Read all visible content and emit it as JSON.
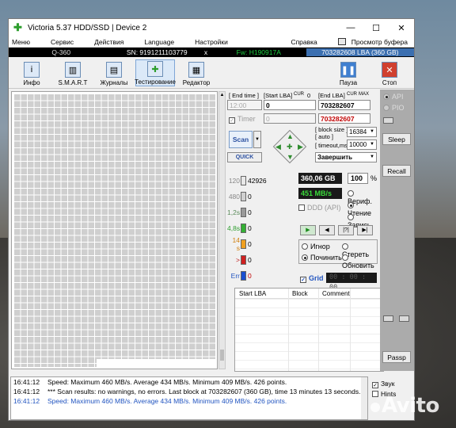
{
  "window": {
    "title": "Victoria 5.37 HDD/SSD | Device 2",
    "minimize": "—",
    "maximize": "☐",
    "close": "✕"
  },
  "menu": {
    "items": [
      "Меню",
      "Сервис",
      "Действия",
      "Language",
      "Настройки",
      "Справка"
    ],
    "clipboard": "Просмотр буфера"
  },
  "infobar": {
    "model": "Q-360",
    "serial": "SN: 9191211103779",
    "sep": "x",
    "firmware": "Fw: H190917A",
    "lba": "703282608 LBA (360 GB)"
  },
  "toolbar": {
    "info": "Инфо",
    "smart": "S.M.A.R.T",
    "logs": "Журналы",
    "testing": "Тестирование",
    "editor": "Редактор",
    "pause": "Пауза",
    "stop": "Стоп"
  },
  "scan": {
    "end_time_label": "[ End time ]",
    "start_lba_label": "[Start LBA]",
    "cur_label": "CUR",
    "cur_value": "0",
    "end_lba_label": "[End LBA]",
    "max_label": "MAX",
    "end_time_value": "12:00",
    "start_lba_value": "0",
    "end_lba_value": "703282607",
    "timer_label": "Timer",
    "timer_value": "0",
    "end_lba_value2": "703282607",
    "scan_button": "Scan",
    "quick_button": "QUICK",
    "block_size_label": "[ block size ]",
    "auto_label": "[ auto ]",
    "block_size_value": "16384",
    "timeout_label": "[ timeout,ms ]",
    "timeout_value": "10000",
    "finish_action": "Завершить"
  },
  "stats": {
    "legend": [
      {
        "ms": "120",
        "count": "42926",
        "color": "#e8e8e8"
      },
      {
        "ms": "480",
        "count": "0",
        "color": "#d0d0d0"
      },
      {
        "ms": "1,2s",
        "count": "0",
        "color": "#9a9a9a"
      },
      {
        "ms": "4,8s",
        "count": "0",
        "color": "#34b034"
      },
      {
        "ms": "14 s",
        "count": "0",
        "color": "#f0a020"
      },
      {
        "ms": ">",
        "count": "0",
        "color": "#d02020"
      },
      {
        "ms": "Err",
        "count": "0",
        "color": "#1a4fd0"
      }
    ],
    "size_done": "360,06 GB",
    "percent_value": "100",
    "percent_sign": "%",
    "speed": "451 MB/s",
    "ddd_label": "DDD (API)",
    "mode_verify": "Вериф.",
    "mode_read": "Чтение",
    "mode_write": "Запись",
    "ignore": "Игнор",
    "erase": "Стереть",
    "repair": "Починить",
    "refresh": "Обновить",
    "grid_label": "Grid",
    "timer_display": "00 : 00 : 00",
    "play_buttons": [
      "▶",
      "◀",
      "|?|",
      "▶|"
    ]
  },
  "table": {
    "headers": [
      "Start LBA",
      "Block",
      "Comment"
    ]
  },
  "rightpanel": {
    "api": "API",
    "pio": "PIO",
    "sleep": "Sleep",
    "recall": "Recall",
    "passp": "Passp"
  },
  "log": [
    {
      "time": "16:41:12",
      "text": "Speed: Maximum 460 MB/s. Average 434 MB/s. Minimum 409 MB/s. 426 points.",
      "color": "black"
    },
    {
      "time": "16:41:12",
      "text": "*** Scan results: no warnings, no errors. Last block at 703282607 (360 GB), time 13 minutes 13 seconds.",
      "color": "black"
    },
    {
      "time": "16:41:12",
      "text": "Speed: Maximum 460 MB/s. Average 434 MB/s. Minimum 409 MB/s. 426 points.",
      "color": "blue"
    }
  ],
  "logside": {
    "sound": "Звук",
    "hints": "Hints"
  },
  "watermark": "Avito"
}
